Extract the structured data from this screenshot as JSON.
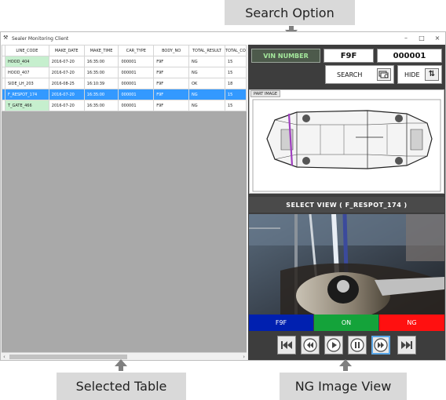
{
  "callouts": {
    "search_option": "Search Option",
    "selected_table": "Selected Table",
    "ng_image_view": "NG Image View"
  },
  "window": {
    "title": "Sealer Monitoring Client",
    "minimize": "–",
    "maximize": "□",
    "close": "×"
  },
  "table": {
    "columns": [
      "LINE_CODE",
      "MAKE_DATE",
      "MAKE_TIME",
      "CAR_TYPE",
      "BODY_NO",
      "TOTAL_RESULT",
      "TOTAL_CO"
    ],
    "rows": [
      [
        "HOOD_404",
        "2016-07-20",
        "16:35:00",
        "000001",
        "F9F",
        "NG",
        "15"
      ],
      [
        "HOOD_407",
        "2016-07-20",
        "16:35:00",
        "000001",
        "F9F",
        "NG",
        "15"
      ],
      [
        "SIDE_LH_203",
        "2016-08-25",
        "16:10:39",
        "000001",
        "F9F",
        "OK",
        "18"
      ],
      [
        "F_RESPOT_174",
        "2016-07-20",
        "16:35:00",
        "000001",
        "F9F",
        "NG",
        "15"
      ],
      [
        "T_GATE_466",
        "2016-07-20",
        "16:35:00",
        "000001",
        "F9F",
        "NG",
        "15"
      ]
    ],
    "selected_row": 3
  },
  "search": {
    "vin_label": "VIN NUMBER",
    "body_no": "F9F",
    "car_type": "000001",
    "search_label": "SEARCH",
    "hide_label": "HIDE"
  },
  "part_image": {
    "tab_label": "PART IMAGE"
  },
  "select_view": {
    "label": "SELECT VIEW",
    "value": "( F_RESPOT_174 )"
  },
  "status": {
    "body": "F9F",
    "on": "ON",
    "ng": "NG"
  },
  "colors": {
    "body_status": "#0020b0",
    "on_status": "#14a33a",
    "ng_status": "#ff1010",
    "selected_row": "#3399ff",
    "highlight_cell": "#c6efce",
    "vin_text": "#a4e89c"
  },
  "icons": {
    "search": "search-stack-icon",
    "hide": "up-down-arrows-icon",
    "nav": [
      "skip-to-start-icon",
      "rewind-icon",
      "play-icon",
      "pause-icon",
      "fast-forward-icon",
      "skip-to-end-icon"
    ]
  }
}
